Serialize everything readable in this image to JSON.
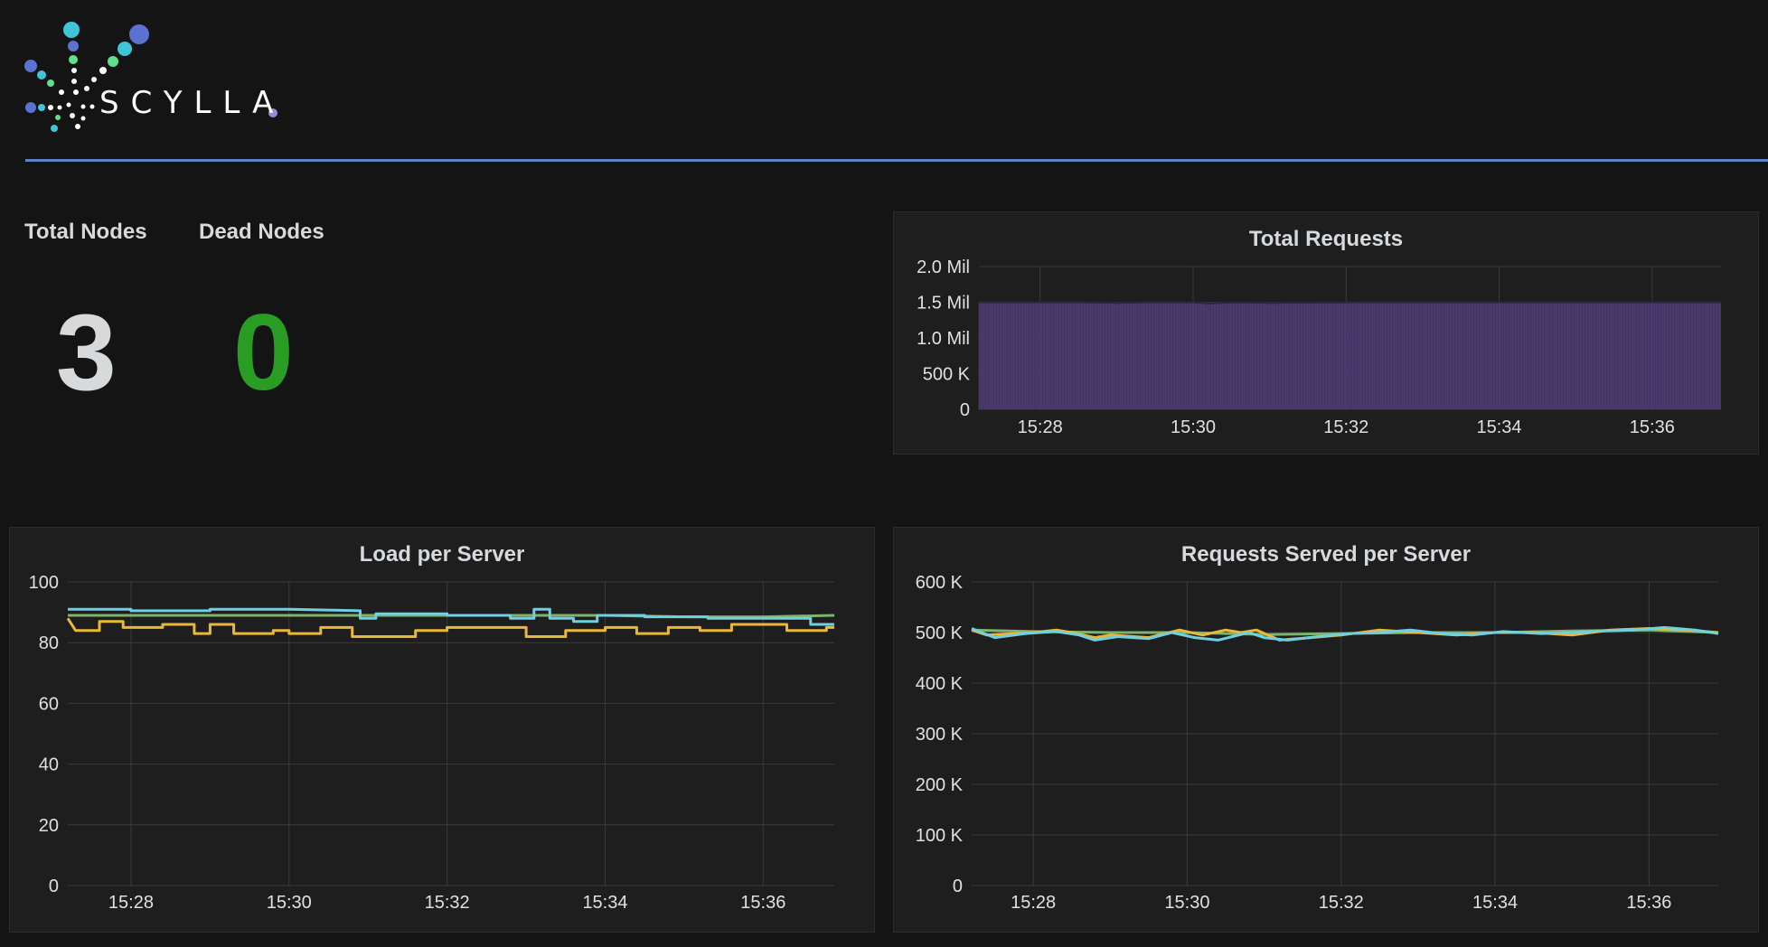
{
  "logo": {
    "text": "SCYLLA"
  },
  "stats": {
    "total_nodes": {
      "label": "Total Nodes",
      "value": "3",
      "color": "#d8d9da"
    },
    "dead_nodes": {
      "label": "Dead Nodes",
      "value": "0",
      "color": "#299c24"
    }
  },
  "colors": {
    "accent_rule": "#5e83c9",
    "series_green": "#7eb26d",
    "series_yellow": "#eab839",
    "series_cyan": "#6ed0e0",
    "area_fill": "#4a3a6e"
  },
  "chart_data": [
    {
      "id": "total_requests",
      "type": "area",
      "title": "Total Requests",
      "x_ticks": [
        "15:28",
        "15:30",
        "15:32",
        "15:34",
        "15:36"
      ],
      "y_ticks": [
        "0",
        "500 K",
        "1.0 Mil",
        "1.5 Mil",
        "2.0 Mil"
      ],
      "ylim": [
        0,
        2000000
      ],
      "xlim_minutes": [
        27.2,
        36.9
      ],
      "grid": true,
      "series": [
        {
          "color": "#4a3a6e",
          "points": [
            [
              27.2,
              1500000
            ],
            [
              28.5,
              1500000
            ],
            [
              29.0,
              1490000
            ],
            [
              29.4,
              1500000
            ],
            [
              30.0,
              1500000
            ],
            [
              30.2,
              1485000
            ],
            [
              30.6,
              1500000
            ],
            [
              31.0,
              1490000
            ],
            [
              31.6,
              1495000
            ],
            [
              32.2,
              1500000
            ],
            [
              33.0,
              1500000
            ],
            [
              34.0,
              1500000
            ],
            [
              35.0,
              1500000
            ],
            [
              36.0,
              1500000
            ],
            [
              36.9,
              1500000
            ]
          ]
        }
      ]
    },
    {
      "id": "load_per_server",
      "type": "line",
      "title": "Load per Server",
      "x_ticks": [
        "15:28",
        "15:30",
        "15:32",
        "15:34",
        "15:36"
      ],
      "y_ticks": [
        "0",
        "20",
        "40",
        "60",
        "80",
        "100"
      ],
      "ylim": [
        0,
        100
      ],
      "xlim_minutes": [
        27.2,
        36.9
      ],
      "grid": true,
      "series": [
        {
          "color": "#7eb26d",
          "points": [
            [
              27.2,
              89
            ],
            [
              28.5,
              89
            ],
            [
              29.5,
              89
            ],
            [
              30.5,
              89
            ],
            [
              31.0,
              89
            ],
            [
              32.0,
              89
            ],
            [
              33.0,
              89
            ],
            [
              34.0,
              89
            ],
            [
              35.0,
              88.5
            ],
            [
              36.0,
              88.5
            ],
            [
              36.9,
              89
            ]
          ]
        },
        {
          "color": "#eab839",
          "points": [
            [
              27.2,
              88
            ],
            [
              27.3,
              84
            ],
            [
              27.6,
              84
            ],
            [
              27.6,
              87
            ],
            [
              27.9,
              87
            ],
            [
              27.9,
              85
            ],
            [
              28.4,
              85
            ],
            [
              28.4,
              86
            ],
            [
              28.8,
              86
            ],
            [
              28.8,
              83
            ],
            [
              29.0,
              83
            ],
            [
              29.0,
              86
            ],
            [
              29.3,
              86
            ],
            [
              29.3,
              83
            ],
            [
              29.8,
              83
            ],
            [
              29.8,
              84
            ],
            [
              30.0,
              84
            ],
            [
              30.0,
              83
            ],
            [
              30.4,
              83
            ],
            [
              30.4,
              85
            ],
            [
              30.8,
              85
            ],
            [
              30.8,
              82
            ],
            [
              31.6,
              82
            ],
            [
              31.6,
              84
            ],
            [
              32.0,
              84
            ],
            [
              32.0,
              85
            ],
            [
              32.5,
              85
            ],
            [
              32.5,
              85
            ],
            [
              33.0,
              85
            ],
            [
              33.0,
              82
            ],
            [
              33.5,
              82
            ],
            [
              33.5,
              84
            ],
            [
              34.0,
              84
            ],
            [
              34.0,
              85
            ],
            [
              34.4,
              85
            ],
            [
              34.4,
              83
            ],
            [
              34.8,
              83
            ],
            [
              34.8,
              85
            ],
            [
              35.2,
              85
            ],
            [
              35.2,
              84
            ],
            [
              35.6,
              84
            ],
            [
              35.6,
              86
            ],
            [
              36.3,
              86
            ],
            [
              36.3,
              84
            ],
            [
              36.8,
              84
            ],
            [
              36.8,
              85
            ],
            [
              36.9,
              85
            ]
          ]
        },
        {
          "color": "#6ed0e0",
          "points": [
            [
              27.2,
              91
            ],
            [
              28.0,
              91
            ],
            [
              28.0,
              90.5
            ],
            [
              29.0,
              90.5
            ],
            [
              29.0,
              91
            ],
            [
              30.0,
              91
            ],
            [
              30.0,
              91
            ],
            [
              30.9,
              90.5
            ],
            [
              30.9,
              88
            ],
            [
              31.1,
              88
            ],
            [
              31.1,
              89.5
            ],
            [
              32.0,
              89.5
            ],
            [
              32.0,
              89
            ],
            [
              32.8,
              89
            ],
            [
              32.8,
              88
            ],
            [
              33.1,
              88
            ],
            [
              33.1,
              91
            ],
            [
              33.3,
              91
            ],
            [
              33.3,
              88
            ],
            [
              33.6,
              88
            ],
            [
              33.6,
              87
            ],
            [
              33.9,
              87
            ],
            [
              33.9,
              89
            ],
            [
              34.5,
              89
            ],
            [
              34.5,
              88.5
            ],
            [
              35.3,
              88.5
            ],
            [
              35.3,
              88
            ],
            [
              36.0,
              88
            ],
            [
              36.0,
              88
            ],
            [
              36.6,
              88
            ],
            [
              36.6,
              86
            ],
            [
              36.9,
              86
            ]
          ]
        }
      ]
    },
    {
      "id": "requests_served_per_server",
      "type": "line",
      "title": "Requests Served per Server",
      "x_ticks": [
        "15:28",
        "15:30",
        "15:32",
        "15:34",
        "15:36"
      ],
      "y_ticks": [
        "0",
        "100 K",
        "200 K",
        "300 K",
        "400 K",
        "500 K",
        "600 K"
      ],
      "ylim": [
        0,
        600000
      ],
      "xlim_minutes": [
        27.2,
        36.9
      ],
      "grid": true,
      "series": [
        {
          "color": "#7eb26d",
          "points": [
            [
              27.2,
              505000
            ],
            [
              28.0,
              502000
            ],
            [
              29.0,
              500000
            ],
            [
              30.0,
              500000
            ],
            [
              31.0,
              496000
            ],
            [
              32.0,
              498000
            ],
            [
              33.0,
              500000
            ],
            [
              34.0,
              500000
            ],
            [
              35.0,
              503000
            ],
            [
              36.0,
              505000
            ],
            [
              36.9,
              500000
            ]
          ]
        },
        {
          "color": "#eab839",
          "points": [
            [
              27.2,
              505000
            ],
            [
              27.4,
              495000
            ],
            [
              28.0,
              500000
            ],
            [
              28.3,
              505000
            ],
            [
              28.5,
              500000
            ],
            [
              28.8,
              490000
            ],
            [
              29.0,
              495000
            ],
            [
              29.5,
              490000
            ],
            [
              29.9,
              505000
            ],
            [
              30.2,
              495000
            ],
            [
              30.5,
              505000
            ],
            [
              30.7,
              500000
            ],
            [
              30.9,
              505000
            ],
            [
              31.2,
              485000
            ],
            [
              31.6,
              490000
            ],
            [
              32.0,
              495000
            ],
            [
              32.5,
              505000
            ],
            [
              33.0,
              500000
            ],
            [
              33.5,
              495000
            ],
            [
              34.0,
              500000
            ],
            [
              34.5,
              500000
            ],
            [
              35.0,
              495000
            ],
            [
              35.5,
              505000
            ],
            [
              36.0,
              508000
            ],
            [
              36.5,
              505000
            ],
            [
              36.9,
              500000
            ]
          ]
        },
        {
          "color": "#6ed0e0",
          "points": [
            [
              27.2,
              508000
            ],
            [
              27.5,
              490000
            ],
            [
              27.9,
              498000
            ],
            [
              28.3,
              502000
            ],
            [
              28.6,
              495000
            ],
            [
              28.8,
              485000
            ],
            [
              29.1,
              492000
            ],
            [
              29.5,
              488000
            ],
            [
              29.8,
              500000
            ],
            [
              30.1,
              490000
            ],
            [
              30.4,
              485000
            ],
            [
              30.8,
              500000
            ],
            [
              31.0,
              490000
            ],
            [
              31.3,
              485000
            ],
            [
              31.7,
              492000
            ],
            [
              32.1,
              498000
            ],
            [
              32.5,
              500000
            ],
            [
              32.9,
              505000
            ],
            [
              33.3,
              498000
            ],
            [
              33.7,
              495000
            ],
            [
              34.1,
              502000
            ],
            [
              34.6,
              498000
            ],
            [
              35.0,
              500000
            ],
            [
              35.4,
              503000
            ],
            [
              35.8,
              505000
            ],
            [
              36.2,
              510000
            ],
            [
              36.6,
              505000
            ],
            [
              36.9,
              498000
            ]
          ]
        }
      ]
    }
  ]
}
